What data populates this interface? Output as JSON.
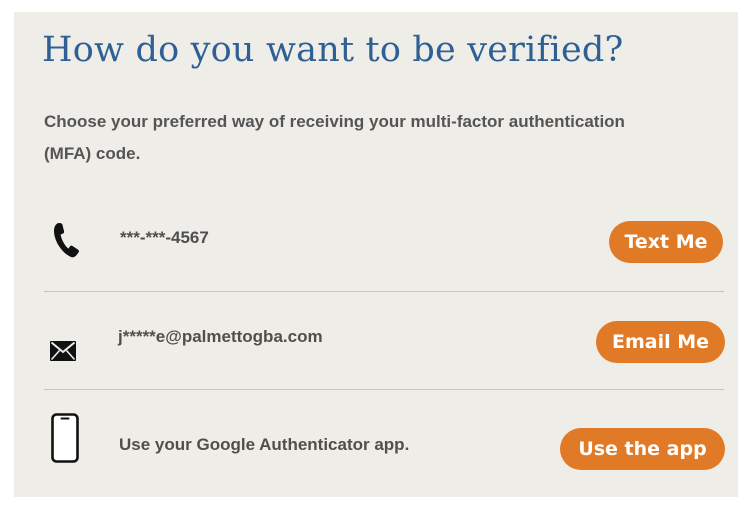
{
  "heading": "How do you want to be verified?",
  "description": "Choose your preferred way of receiving your multi-factor authentication (MFA) code.",
  "options": [
    {
      "icon": "phone-icon",
      "text": "***-***-4567",
      "button": "Text Me"
    },
    {
      "icon": "envelope-icon",
      "text": "j*****e@palmettogba.com",
      "button": "Email Me"
    },
    {
      "icon": "smartphone-icon",
      "text": "Use your Google Authenticator app.",
      "button": "Use the app"
    }
  ],
  "colors": {
    "heading": "#2f6094",
    "button": "#e17a26",
    "panel": "#efede8"
  }
}
